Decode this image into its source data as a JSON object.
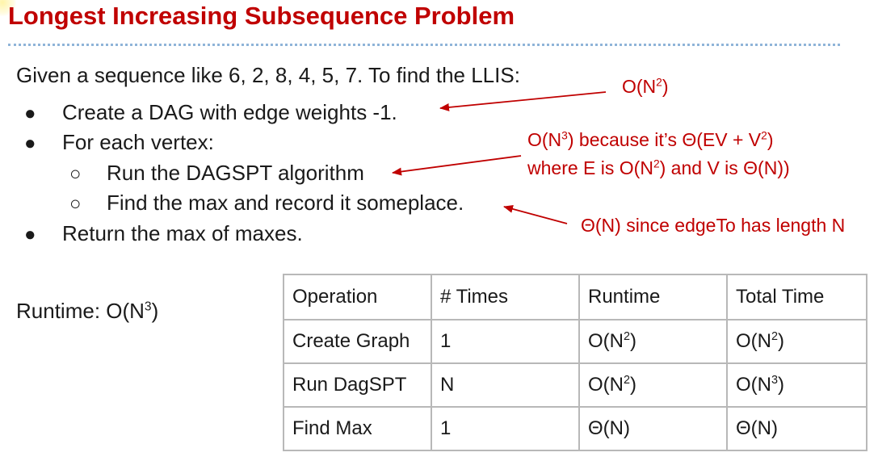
{
  "title": "Longest Increasing Subsequence Problem",
  "intro": "Given a sequence like 6, 2, 8, 4, 5, 7. To find the LLIS:",
  "bullets": {
    "create_dag": "Create a DAG with edge weights -1.",
    "for_each_vertex": "For each vertex:",
    "run_dagspt": "Run the DAGSPT algorithm",
    "find_max": "Find the max and record it someplace.",
    "return_max": "Return the max of maxes."
  },
  "bullet_symbols": {
    "level1": "●",
    "level2": "○"
  },
  "annotations": {
    "create_dag_cost": {
      "base": "O(N",
      "exp": "2",
      "close": ")"
    },
    "dagspt_line1": {
      "a": "O(N",
      "exp1": "3",
      "b": ") because it’s Θ(EV + V",
      "exp2": "2",
      "c": ")"
    },
    "dagspt_line2": {
      "a": "where E is O(N",
      "exp1": "2",
      "b": ") and V is Θ(N))"
    },
    "find_max_cost": "Θ(N) since edgeTo has length N"
  },
  "runtime": {
    "label": "Runtime: O(N",
    "exp": "3",
    "close": ")"
  },
  "table": {
    "headers": [
      "Operation",
      "# Times",
      "Runtime",
      "Total Time"
    ],
    "rows": [
      {
        "operation": "Create Graph",
        "times": "1",
        "runtime": {
          "base": "O(N",
          "exp": "2",
          "close": ")"
        },
        "total": {
          "base": "O(N",
          "exp": "2",
          "close": ")"
        }
      },
      {
        "operation": "Run DagSPT",
        "times": "N",
        "runtime": {
          "base": "O(N",
          "exp": "2",
          "close": ")"
        },
        "total": {
          "base": "O(N",
          "exp": "3",
          "close": ")"
        }
      },
      {
        "operation": "Find Max",
        "times": "1",
        "runtime": {
          "base": "Θ(N)",
          "exp": "",
          "close": ""
        },
        "total": {
          "base": "Θ(N)",
          "exp": "",
          "close": ""
        }
      }
    ]
  },
  "colors": {
    "title": "#c00000",
    "annotation": "#c00000",
    "rule": "#8fb4d8",
    "table_border": "#b8b8b8"
  }
}
